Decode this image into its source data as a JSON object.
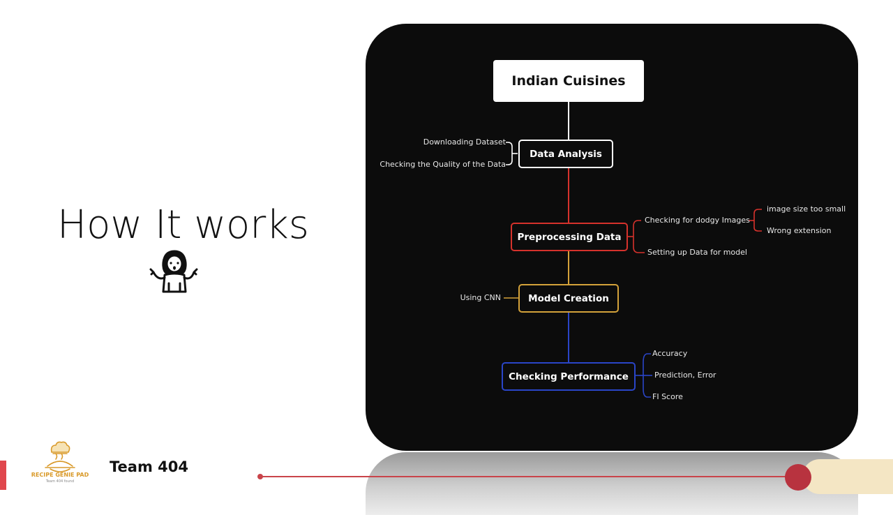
{
  "slide": {
    "title": "How It works",
    "team_label": "Team 404",
    "logo_name": "RECIPE GENIE PAD",
    "logo_tagline": "Team 404 found"
  },
  "colors": {
    "analysis": "#ffffff",
    "preprocessing": "#d6322c",
    "model": "#d4a23a",
    "performance": "#2a45c8",
    "accent_red": "#c9444a",
    "accent_cream": "#f4e6c4",
    "logo_gold": "#d99a2a"
  },
  "icons": {
    "presenter": "shrug-person-icon",
    "logo": "chef-hat-icon"
  },
  "diagram": {
    "root": "Indian Cuisines",
    "nodes": [
      {
        "label": "Data Analysis",
        "leaves": [
          "Downloading Dataset",
          "Checking the Quality of the Data"
        ]
      },
      {
        "label": "Preprocessing Data",
        "leaves": [
          "Checking for dodgy Images",
          "Setting up Data for model"
        ],
        "subleaves": [
          "image size too small",
          "Wrong extension"
        ]
      },
      {
        "label": "Model Creation",
        "leaves": [
          "Using CNN"
        ]
      },
      {
        "label": "Checking Performance",
        "leaves": [
          "Accuracy",
          "Prediction, Error",
          "FI Score"
        ]
      }
    ]
  }
}
